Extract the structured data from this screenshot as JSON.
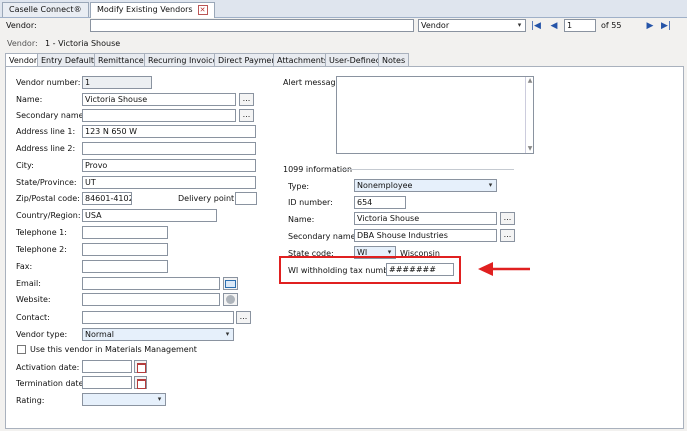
{
  "tabs": {
    "caselle_connect": "Caselle Connect®",
    "modify_vendors": "Modify Existing Vendors"
  },
  "toolbar": {
    "vendor_label": "Vendor:",
    "search_value": "",
    "type_value": "Vendor",
    "record": "1",
    "of_total": "of 55"
  },
  "breadcrumb": {
    "label": "Vendor:",
    "value": "1 - Victoria Shouse"
  },
  "subtabs": [
    "Vendor",
    "Entry Defaults",
    "Remittances",
    "Recurring Invoices",
    "Direct Payment",
    "Attachments",
    "User-Defined",
    "Notes"
  ],
  "left": {
    "vendor_number": {
      "label": "Vendor number:",
      "value": "1"
    },
    "name": {
      "label": "Name:",
      "value": "Victoria Shouse"
    },
    "secondary_name": {
      "label": "Secondary name:",
      "value": ""
    },
    "address1": {
      "label": "Address line 1:",
      "value": "123 N 650 W"
    },
    "address2": {
      "label": "Address line 2:",
      "value": ""
    },
    "city": {
      "label": "City:",
      "value": "Provo"
    },
    "state": {
      "label": "State/Province:",
      "value": "UT"
    },
    "zip": {
      "label": "Zip/Postal code:",
      "value": "84601-4102"
    },
    "delivery": {
      "label": "Delivery point:",
      "value": ""
    },
    "country": {
      "label": "Country/Region:",
      "value": "USA"
    },
    "tel1": {
      "label": "Telephone 1:",
      "value": ""
    },
    "tel2": {
      "label": "Telephone 2:",
      "value": ""
    },
    "fax": {
      "label": "Fax:",
      "value": ""
    },
    "email": {
      "label": "Email:",
      "value": ""
    },
    "website": {
      "label": "Website:",
      "value": ""
    },
    "contact": {
      "label": "Contact:",
      "value": ""
    },
    "vendor_type": {
      "label": "Vendor type:",
      "value": "Normal"
    },
    "materials": {
      "label": "Use this vendor in Materials Management",
      "checked": false
    },
    "activation": {
      "label": "Activation date:",
      "value": ""
    },
    "termination": {
      "label": "Termination date:",
      "value": ""
    },
    "rating": {
      "label": "Rating:",
      "value": ""
    }
  },
  "right": {
    "alert": {
      "label": "Alert message:",
      "value": ""
    },
    "section_1099": "1099 information",
    "type": {
      "label": "Type:",
      "value": "Nonemployee"
    },
    "id_number": {
      "label": "ID number:",
      "value": "654"
    },
    "name": {
      "label": "Name:",
      "value": "Victoria Shouse"
    },
    "secondary_name": {
      "label": "Secondary name:",
      "value": "DBA Shouse Industries"
    },
    "state_code": {
      "label": "State code:",
      "value": "WI",
      "state_name": "Wisconsin"
    },
    "wi_withholding": {
      "label": "WI withholding tax number:",
      "value": "#######"
    }
  },
  "colors": {
    "highlight": "#e02020",
    "arrow": "#e02020",
    "accent": "#2554a8"
  },
  "icons": {
    "close": "close-icon",
    "first": "first-record-icon",
    "prev": "prev-record-icon",
    "next": "next-record-icon",
    "last": "last-record-icon",
    "lookup": "ellipsis-icon",
    "email": "email-icon",
    "web": "globe-icon",
    "calendar": "calendar-icon",
    "dropdown": "chevron-down-icon",
    "arrow": "arrow-left-icon"
  }
}
